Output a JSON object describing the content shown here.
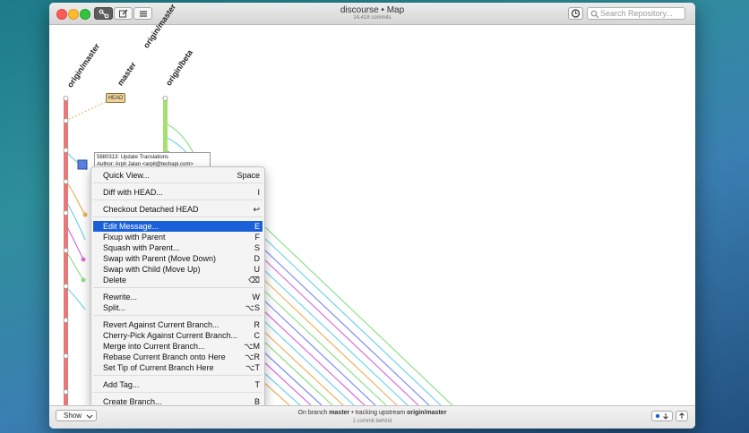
{
  "window": {
    "title": "discourse • Map",
    "subtitle": "14,418 commits"
  },
  "toolbar": {
    "map_icon": "branch-map-icon",
    "edit_icon": "compose-icon",
    "list_icon": "list-icon",
    "history_icon": "clock-icon",
    "search_placeholder": "Search Repository..."
  },
  "graph": {
    "branches": [
      {
        "label": "origin/master"
      },
      {
        "label": "master"
      },
      {
        "label": "origin/master"
      },
      {
        "label": "origin/beta"
      }
    ],
    "head_tag": "HEAD",
    "tooltip": {
      "hash": "5880313",
      "message": ": Update Translations",
      "author_line": "Author: Arpit Jalan <arpit@techapi.com>"
    },
    "colors": {
      "master": "#e57979",
      "beta": "#a6e06e",
      "cyan": "#6fd3e8",
      "magenta": "#d86fd6",
      "orange": "#e9b35f",
      "blue": "#7c8df0",
      "green": "#8ee08c"
    }
  },
  "context_menu": {
    "items": [
      {
        "label": "Quick View...",
        "shortcut": "Space"
      },
      {
        "label": "Diff with HEAD...",
        "shortcut": "I"
      },
      {
        "label": "Checkout Detached HEAD",
        "shortcut": "↩"
      },
      {
        "label": "Edit Message...",
        "shortcut": "E"
      },
      {
        "label": "Fixup with Parent",
        "shortcut": "F"
      },
      {
        "label": "Squash with Parent...",
        "shortcut": "S"
      },
      {
        "label": "Swap with Parent (Move Down)",
        "shortcut": "D"
      },
      {
        "label": "Swap with Child (Move Up)",
        "shortcut": "U"
      },
      {
        "label": "Delete",
        "shortcut": "⌫"
      },
      {
        "label": "Rewrite...",
        "shortcut": "W"
      },
      {
        "label": "Split...",
        "shortcut": "⌥S"
      },
      {
        "label": "Revert Against Current Branch...",
        "shortcut": "R"
      },
      {
        "label": "Cherry-Pick Against Current Branch...",
        "shortcut": "C"
      },
      {
        "label": "Merge into Current Branch...",
        "shortcut": "⌥M"
      },
      {
        "label": "Rebase Current Branch onto Here",
        "shortcut": "⌥R"
      },
      {
        "label": "Set Tip of Current Branch Here",
        "shortcut": "⌥T"
      },
      {
        "label": "Add Tag...",
        "shortcut": "T"
      },
      {
        "label": "Create Branch...",
        "shortcut": "B"
      }
    ],
    "highlight_color": "#1a61d8"
  },
  "bottom": {
    "show_label": "Show",
    "status_prefix": "On branch ",
    "branch": "master",
    "status_mid": " • tracking upstream ",
    "upstream": "origin/master",
    "behind": "1 commit behind"
  }
}
